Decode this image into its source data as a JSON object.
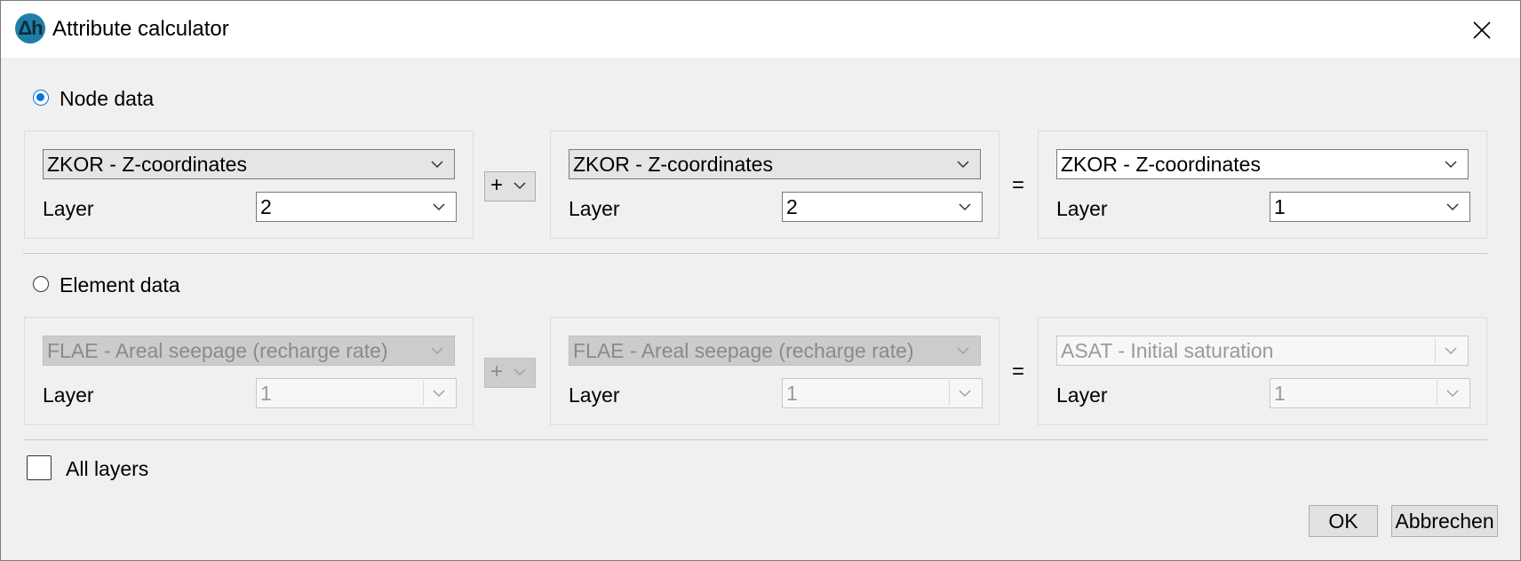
{
  "window": {
    "title": "Attribute calculator",
    "icon": "delta-h-app-icon"
  },
  "node": {
    "label": "Node data",
    "selected": true,
    "operand1": {
      "attribute": "ZKOR - Z-coordinates",
      "layer_label": "Layer",
      "layer": "2"
    },
    "operator": "+",
    "operand2": {
      "attribute": "ZKOR - Z-coordinates",
      "layer_label": "Layer",
      "layer": "2"
    },
    "equals": "=",
    "result": {
      "attribute": "ZKOR - Z-coordinates",
      "layer_label": "Layer",
      "layer": "1"
    }
  },
  "element": {
    "label": "Element data",
    "selected": false,
    "operand1": {
      "attribute": "FLAE - Areal seepage (recharge rate)",
      "layer_label": "Layer",
      "layer": "1"
    },
    "operator": "+",
    "operand2": {
      "attribute": "FLAE - Areal seepage (recharge rate)",
      "layer_label": "Layer",
      "layer": "1"
    },
    "equals": "=",
    "result": {
      "attribute": "ASAT - Initial saturation",
      "layer_label": "Layer",
      "layer": "1"
    }
  },
  "all_layers": {
    "label": "All layers",
    "checked": false
  },
  "buttons": {
    "ok": "OK",
    "cancel": "Abbrechen"
  }
}
